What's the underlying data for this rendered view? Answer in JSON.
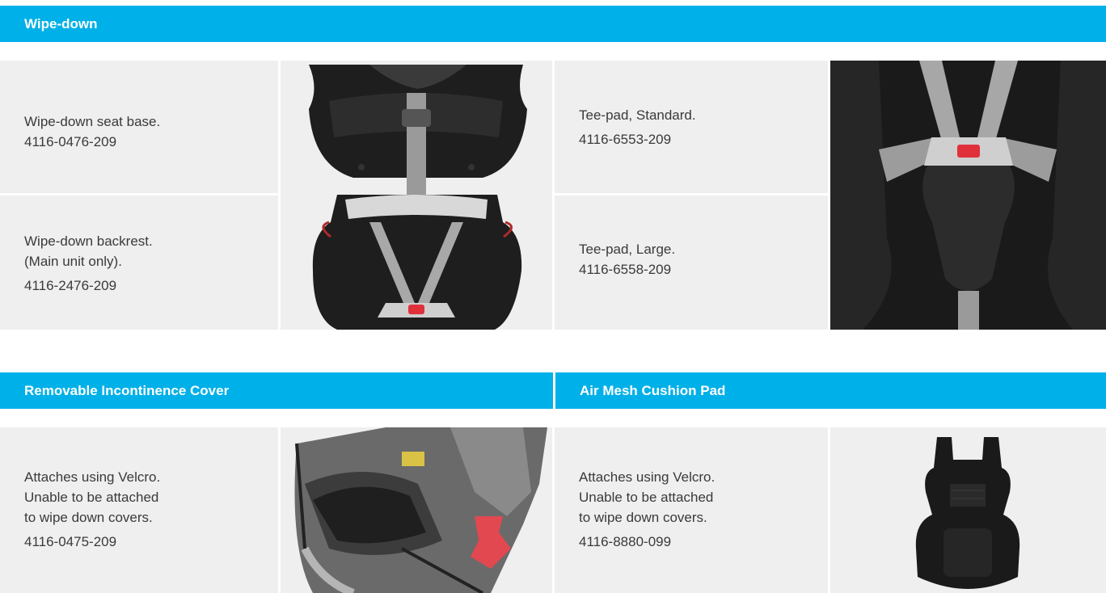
{
  "sections": {
    "wipe_down": {
      "title": "Wipe-down"
    },
    "incontinence": {
      "title": "Removable Incontinence Cover"
    },
    "air_mesh": {
      "title": "Air Mesh Cushion Pad"
    }
  },
  "items": {
    "seat_base": {
      "line1": "Wipe-down seat base.",
      "part": "4116-0476-209"
    },
    "backrest": {
      "line1": "Wipe-down backrest.",
      "line2": "(Main unit only).",
      "part": "4116-2476-209"
    },
    "tee_standard": {
      "line1": "Tee-pad, Standard.",
      "part": "4116-6553-209"
    },
    "tee_large": {
      "line1": "Tee-pad, Large.",
      "part": "4116-6558-209"
    },
    "incontinence_cover": {
      "line1": "Attaches using Velcro.",
      "line2": "Unable to be attached",
      "line3": "to wipe down covers.",
      "part": "4116-0475-209"
    },
    "air_mesh_pad": {
      "line1": "Attaches using Velcro.",
      "line2": "Unable to be attached",
      "line3": "to wipe down covers.",
      "part": "4116-8880-099"
    }
  },
  "colors": {
    "accent": "#00b0e8",
    "cell_bg": "#efefef",
    "text": "#3a3a3a"
  }
}
